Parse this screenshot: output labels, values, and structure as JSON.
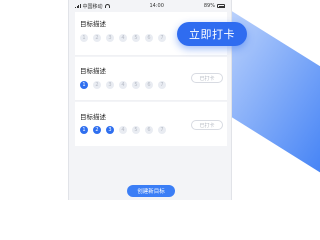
{
  "status_bar": {
    "carrier": "中国移动",
    "time": "14:00",
    "battery": "89%"
  },
  "goals": [
    {
      "title": "目标描述",
      "days": [
        "1",
        "2",
        "3",
        "4",
        "5",
        "6",
        "7"
      ],
      "checked_count": 0,
      "checkin_label": ""
    },
    {
      "title": "目标描述",
      "days": [
        "1",
        "2",
        "3",
        "4",
        "5",
        "6",
        "7"
      ],
      "checked_count": 1,
      "checkin_label": "已打卡"
    },
    {
      "title": "目标描述",
      "days": [
        "1",
        "2",
        "3",
        "4",
        "5",
        "6",
        "7"
      ],
      "checked_count": 3,
      "checkin_label": "已打卡"
    }
  ],
  "create_button": "创建新目标",
  "checkin_button": "立即打卡",
  "colors": {
    "accent": "#2f6cf0",
    "background": "#f3f4f7"
  }
}
